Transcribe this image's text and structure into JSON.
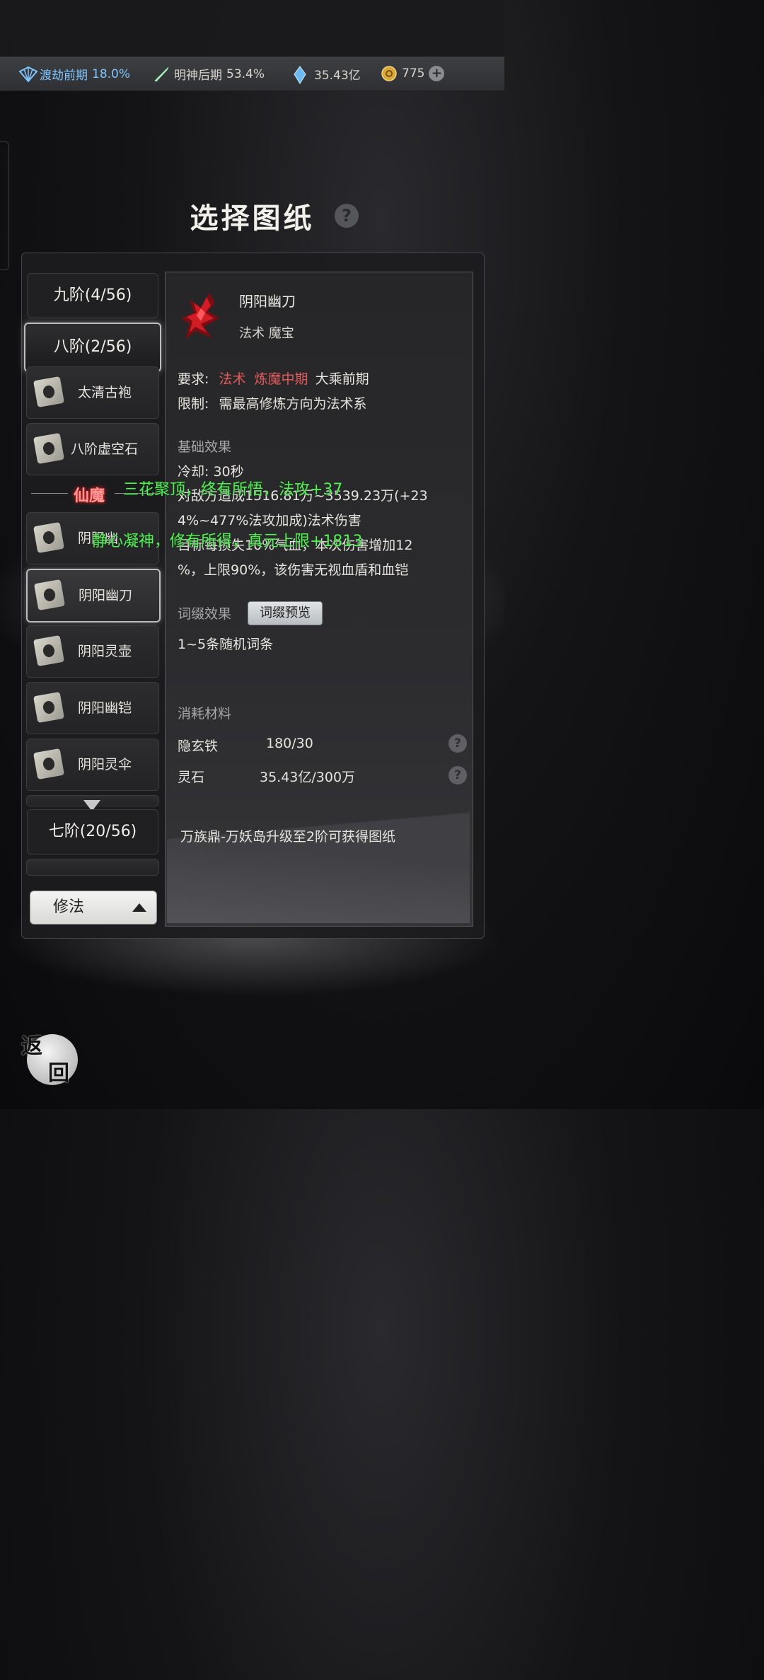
{
  "resources": {
    "realm1_label": "渡劫前期",
    "realm1_value": "18.0%",
    "realm2_label": "明神后期",
    "realm2_value": "53.4%",
    "crystal_value": "35.43亿",
    "coin_value": "775",
    "add": "+"
  },
  "title": "选择图纸",
  "help": "?",
  "sidebar": {
    "tier9": "九阶(4/56)",
    "tier8": "八阶(2/56)",
    "items_top": [
      "太清古袍",
      "八阶虚空石"
    ],
    "divider": "仙魔",
    "items_bottom": [
      "阴阳幽",
      "阴阳幽刀",
      "阴阳灵壶",
      "阴阳幽铠",
      "阴阳灵伞"
    ],
    "tier7": "七阶(20/56)",
    "filter": "修法"
  },
  "detail": {
    "name": "阴阳幽刀",
    "type": "法术  魔宝",
    "req_label": "要求:",
    "req_red1": "法术",
    "req_red2": "炼魔中期",
    "req_rest": "大乘前期",
    "limit_label": "限制:",
    "limit_value": "需最高修炼方向为法术系",
    "base_title": "基础效果",
    "cooldown": "冷却: 30秒",
    "effect1": "对敌方造成1516.81万~3539.23万(+23",
    "effect2": "4%~477%法攻加成)法术伤害",
    "effect3": "目标每损失10%气血，本次伤害增加12",
    "effect4": "%，上限90%，该伤害无视血盾和血铠",
    "affix_title": "词缀效果",
    "affix_button": "词缀预览",
    "affix_value": "1~5条随机词条",
    "cost_title": "消耗材料",
    "mat1_name": "隐玄铁",
    "mat1_value": "180/30",
    "mat2_name": "灵石",
    "mat2_value": "35.43亿/300万",
    "source": "万族鼎-万妖岛升级至2阶可获得图纸"
  },
  "overlay": {
    "line1": "三花聚顶，终有所悟，法攻+37",
    "line2": "静心凝神，修有所得，真元上限+1813"
  },
  "back": {
    "char1": "返",
    "char2": "回"
  },
  "colors": {
    "accent_blue": "#7fc6ff",
    "requirement_red": "#e35b5b",
    "overlay_green": "#5bea5b",
    "divider_glow": "#ff2a2a"
  }
}
